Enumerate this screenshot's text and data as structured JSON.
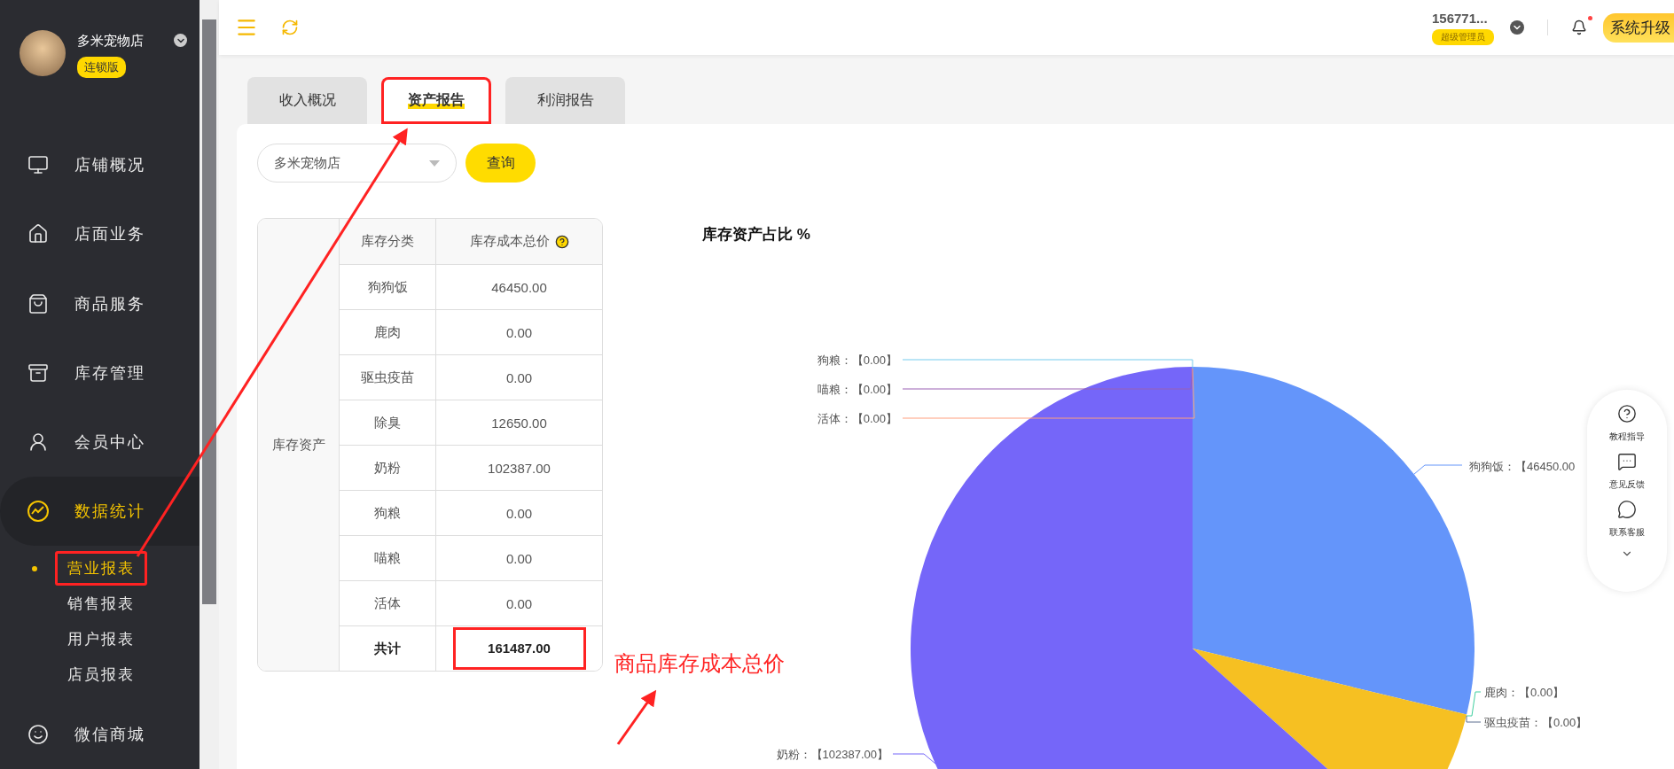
{
  "sidebar": {
    "store_name": "多米宠物店",
    "edition": "连锁版",
    "items": [
      {
        "label": "店铺概况",
        "selected": false
      },
      {
        "label": "店面业务",
        "selected": false
      },
      {
        "label": "商品服务",
        "selected": false
      },
      {
        "label": "库存管理",
        "selected": false
      },
      {
        "label": "会员中心",
        "selected": false
      },
      {
        "label": "数据统计",
        "selected": true,
        "children": [
          {
            "label": "营业报表",
            "selected": true,
            "callout": true
          },
          {
            "label": "销售报表",
            "selected": false,
            "callout": false
          },
          {
            "label": "用户报表",
            "selected": false,
            "callout": false
          },
          {
            "label": "店员报表",
            "selected": false,
            "callout": false
          }
        ]
      },
      {
        "label": "微信商城",
        "selected": false
      }
    ]
  },
  "topbar": {
    "user": "156771...",
    "role": "超级管理员",
    "has_notification": true,
    "upgrade_button": "系统升级"
  },
  "tabs": [
    {
      "label": "收入概况",
      "selected": false,
      "callout": false
    },
    {
      "label": "资产报告",
      "selected": true,
      "callout": true
    },
    {
      "label": "利润报告",
      "selected": false,
      "callout": false
    }
  ],
  "filter": {
    "store": "多米宠物店",
    "query_button": "查询"
  },
  "inventory_table": {
    "group_label": "库存资产",
    "columns": [
      "库存分类",
      "库存成本总价"
    ],
    "rows": [
      {
        "category": "狗狗饭",
        "total": "46450.00"
      },
      {
        "category": "鹿肉",
        "total": "0.00"
      },
      {
        "category": "驱虫疫苗",
        "total": "0.00"
      },
      {
        "category": "除臭",
        "total": "12650.00"
      },
      {
        "category": "奶粉",
        "total": "102387.00"
      },
      {
        "category": "狗粮",
        "total": "0.00"
      },
      {
        "category": "喵粮",
        "total": "0.00"
      },
      {
        "category": "活体",
        "total": "0.00"
      }
    ],
    "total": {
      "label": "共计",
      "value": "161487.00",
      "callout": true
    }
  },
  "chart": {
    "chart_data": {
      "type": "pie",
      "title": "库存资产占比 %",
      "categories": [
        "狗狗饭",
        "鹿肉",
        "驱虫疫苗",
        null,
        "奶粉",
        "狗粮",
        "喵粮",
        "活体"
      ],
      "values": [
        46450,
        0,
        0,
        12650,
        102387,
        0,
        0,
        0
      ],
      "colors": [
        "#6495fa",
        "#3fcf9f",
        "#5d6f8f",
        "#f6c022",
        "#7566f9",
        "#74cbed",
        "#9a60b4",
        "#ff9f7f"
      ],
      "value_labels": [
        "：【46450.00",
        "：【0.00】",
        "：【0.00】",
        null,
        "：【102387.00】",
        "：【0.00】",
        "：【0.00】",
        "：【0.00】"
      ]
    }
  },
  "help_panel": {
    "items": [
      "教程指导",
      "意见反馈",
      "联系客服"
    ]
  },
  "annotation": {
    "note": "商品库存成本总价"
  }
}
